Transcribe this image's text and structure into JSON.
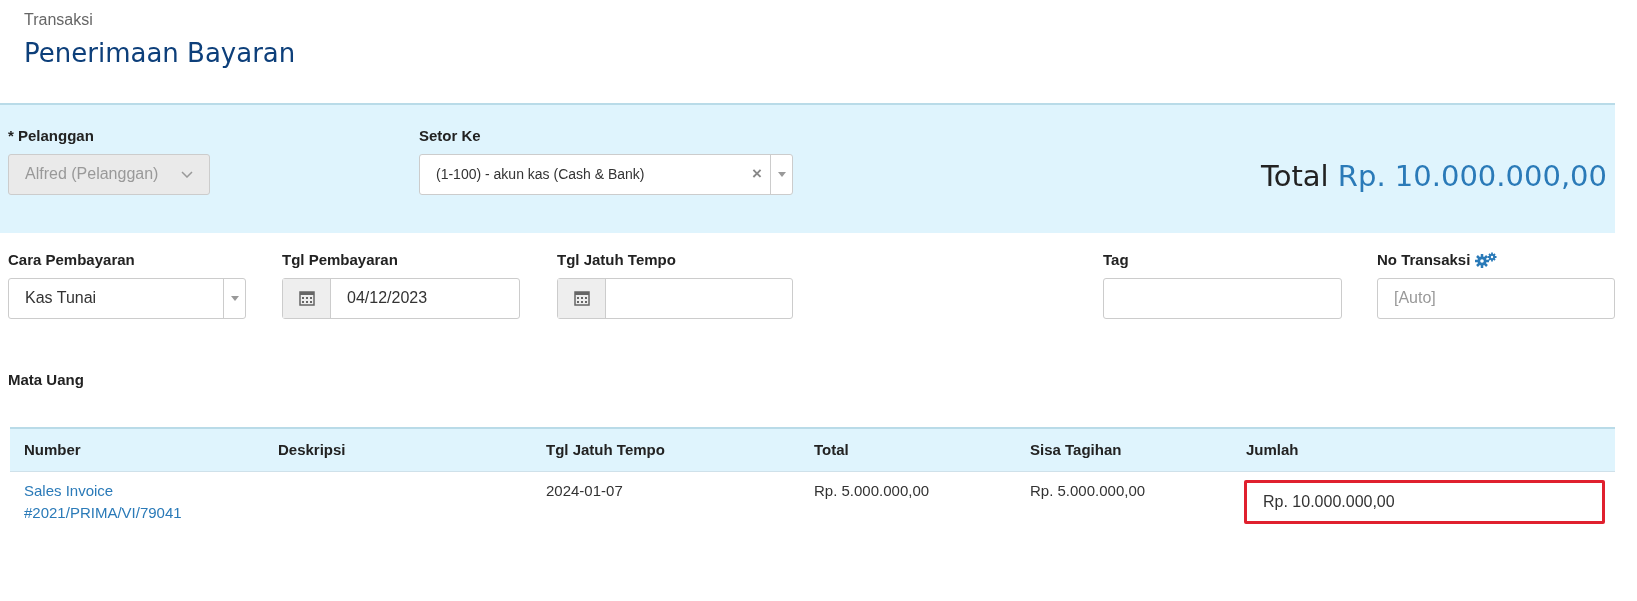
{
  "header": {
    "breadcrumb": "Transaksi",
    "title": "Penerimaan Bayaran"
  },
  "customer": {
    "label": "* Pelanggan",
    "value": "Alfred (Pelanggan)",
    "disabled": true
  },
  "deposit_to": {
    "label": "Setor Ke",
    "value": "(1-100) - akun kas (Cash & Bank)",
    "clear": "×"
  },
  "total": {
    "label": "Total",
    "amount": "Rp. 10.000.000,00"
  },
  "fields": [
    {
      "kind": "select",
      "label": "Cara Pembayaran",
      "value": "Kas Tunai"
    },
    {
      "kind": "date",
      "label": "Tgl Pembayaran",
      "value": "04/12/2023"
    },
    {
      "kind": "date",
      "label": "Tgl Jatuh Tempo"
    },
    {
      "kind": "text",
      "label": "Tag"
    },
    {
      "kind": "text",
      "label": "No Transaksi",
      "placeholder": "[Auto]",
      "settings": true
    }
  ],
  "currency_label": "Mata Uang",
  "table": {
    "columns": [
      "Number",
      "Deskripsi",
      "Tgl Jatuh Tempo",
      "Total",
      "Sisa Tagihan",
      "Jumlah"
    ],
    "rows": [
      {
        "number": [
          "Sales Invoice",
          "#2021/PRIMA/VI/79041"
        ],
        "due": "2024-01-07",
        "total": "Rp. 5.000.000,00",
        "remaining": "Rp. 5.000.000,00",
        "amount": "Rp. 10.000.000,00",
        "highlighted": true
      }
    ]
  }
}
